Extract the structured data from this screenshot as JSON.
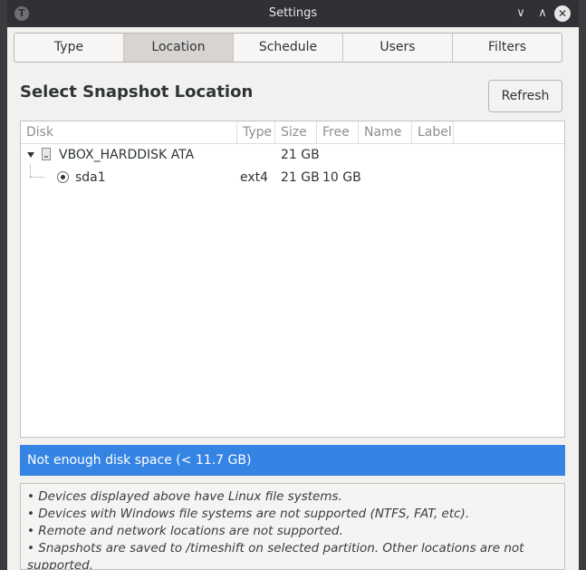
{
  "window": {
    "title": "Settings",
    "app_icon_letter": "T"
  },
  "titlebar_buttons": {
    "minimize": "∨",
    "maximize": "∧",
    "close": "✕"
  },
  "tabs": [
    {
      "label": "Type",
      "active": false
    },
    {
      "label": "Location",
      "active": true
    },
    {
      "label": "Schedule",
      "active": false
    },
    {
      "label": "Users",
      "active": false
    },
    {
      "label": "Filters",
      "active": false
    }
  ],
  "heading": "Select Snapshot Location",
  "refresh_label": "Refresh",
  "columns": {
    "disk": "Disk",
    "type": "Type",
    "size": "Size",
    "free": "Free",
    "name": "Name",
    "label": "Label"
  },
  "devices": [
    {
      "disk": "VBOX_HARDDISK ATA",
      "type": "",
      "size": "21 GB",
      "free": "",
      "name": "",
      "label": ""
    },
    {
      "disk": "sda1",
      "type": "ext4",
      "size": "21 GB",
      "free": "10 GB",
      "name": "",
      "label": "",
      "selected": true
    }
  ],
  "status_message": "Not enough disk space (< 11.7 GB)",
  "status_color": "#3584e4",
  "notes": [
    "• Devices displayed above have Linux file systems.",
    "• Devices with Windows file systems are not supported (NTFS, FAT, etc).",
    "• Remote and network locations are not supported.",
    "• Snapshots are saved to /timeshift on selected partition. Other locations are not",
    "supported."
  ]
}
